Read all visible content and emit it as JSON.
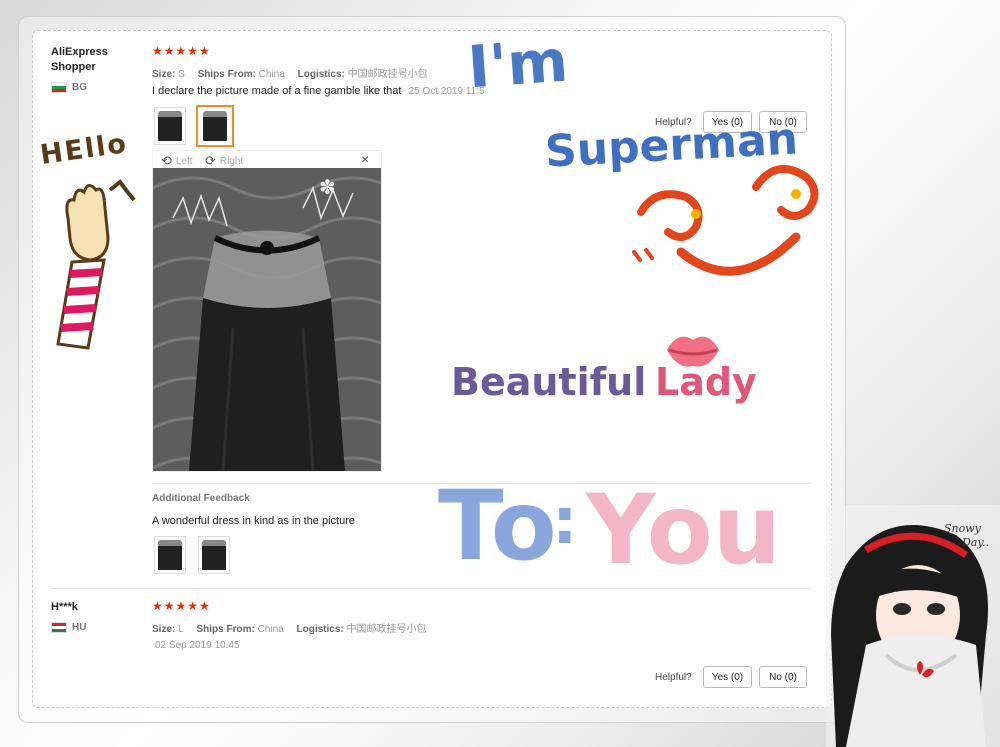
{
  "reviews": [
    {
      "name": "AliExpress Shopper",
      "country": "BG",
      "stars": "★★★★★",
      "size_label": "Size:",
      "size": "S",
      "ships_label": "Ships From:",
      "ships": "China",
      "logistics_label": "Logistics:",
      "logistics": "中国邮政挂号小包",
      "text": "I declare the picture made of a fine gamble like that",
      "date": "25 Oct 2019 11:5",
      "helpful_label": "Helpful?",
      "yes_label": "Yes (0)",
      "no_label": "No (0)",
      "viewer": {
        "left_label": "Left",
        "right_label": "Right",
        "close": "×"
      },
      "additional": {
        "heading": "Additional Feedback",
        "text": "A wonderful dress in kind as in the picture"
      }
    },
    {
      "name": "H***k",
      "country": "HU",
      "stars": "★★★★★",
      "size_label": "Size:",
      "size": "L",
      "ships_label": "Ships From:",
      "ships": "China",
      "logistics_label": "Logistics:",
      "logistics": "中国邮政挂号小包",
      "date": "02 Sep 2019 10:45",
      "helpful_label": "Helpful?",
      "yes_label": "Yes (0)",
      "no_label": "No (0)"
    }
  ],
  "decorations": {
    "hello": "HEllo",
    "im": "I'm",
    "superman": "Superman",
    "beautiful": "Beautiful",
    "lady": "Lady",
    "to": "To",
    "colon": ":",
    "you": "You",
    "snowy": "Snowy",
    "day": "Day.."
  },
  "colors": {
    "star": "#e62e04",
    "thumb_active_border": "#f08a2f",
    "im_blue": "#4a79c4",
    "superman_blue": "#3f6fc0",
    "face_red": "#e4461c",
    "beautiful_purple": "#6a5a99",
    "lady_pink": "#e0577a",
    "to_blue": "#8aa7dd",
    "you_pink": "#f2b6c8"
  }
}
